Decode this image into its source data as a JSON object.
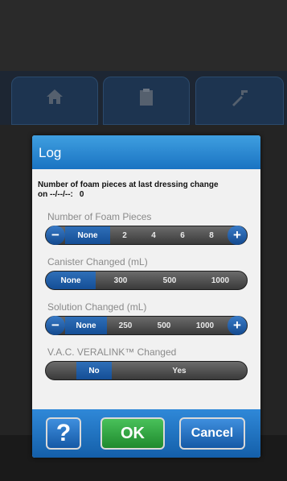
{
  "dialog": {
    "title": "Log",
    "info_line1": "Number of foam pieces at last dressing change",
    "info_line2_prefix": "on --/--/--:",
    "info_value": "0"
  },
  "foam": {
    "label": "Number of Foam Pieces",
    "minus": "−",
    "plus": "+",
    "options": [
      "None",
      "2",
      "4",
      "6",
      "8"
    ],
    "selected": "None"
  },
  "canister": {
    "label": "Canister Changed (mL)",
    "options": [
      "None",
      "300",
      "500",
      "1000"
    ],
    "selected": "None"
  },
  "solution": {
    "label": "Solution Changed (mL)",
    "minus": "−",
    "plus": "+",
    "options": [
      "None",
      "250",
      "500",
      "1000"
    ],
    "selected": "None"
  },
  "veralink": {
    "label": "V.A.C. VERALINK™ Changed",
    "options": [
      "No",
      "Yes"
    ],
    "selected": "No"
  },
  "buttons": {
    "help": "?",
    "ok": "OK",
    "cancel": "Cancel"
  },
  "colors": {
    "header_blue": "#1a73c2",
    "selected_blue": "#144e96",
    "ok_green": "#1f8a2e"
  },
  "background_tabs": {
    "icons": [
      "home-icon",
      "clipboard-icon",
      "tools-icon"
    ]
  }
}
